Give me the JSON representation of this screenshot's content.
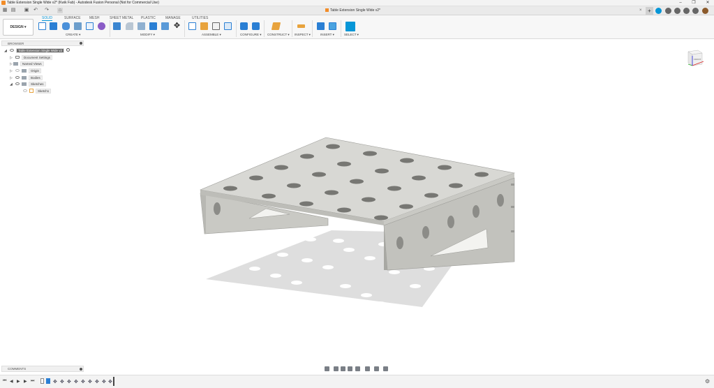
{
  "window": {
    "title": "Table Extension Single Wide v2* (Kwik Fab) - Autodesk Fusion Personal (Not for Commercial Use)",
    "minimize_label": "–",
    "maximize_label": "❐",
    "close_label": "✕"
  },
  "tabbar": {
    "document_tab": "Table Extension Single Wide v2*",
    "close_glyph": "×",
    "add_glyph": "+"
  },
  "ribbon": {
    "workspace": "DESIGN ▾",
    "tabs": [
      "SOLID",
      "SURFACE",
      "MESH",
      "SHEET METAL",
      "PLASTIC",
      "MANAGE",
      "UTILITIES"
    ],
    "active_tab": "SOLID",
    "groups": [
      "CREATE ▾",
      "MODIFY ▾",
      "ASSEMBLE ▾",
      "CONFIGURE ▾",
      "CONSTRUCT ▾",
      "INSPECT ▾",
      "INSERT ▾",
      "SELECT ▾"
    ]
  },
  "browser": {
    "header": "BROWSER",
    "root": "Table Extension Single Wide v2",
    "items": [
      "Document Settings",
      "Named Views",
      "Origin",
      "Bodies",
      "Sketches"
    ],
    "sketch": "Sketch1"
  },
  "viewcube": {
    "face_label": "FRONT"
  },
  "comments": {
    "label": "COMMENTS"
  },
  "timeline": {
    "play_controls": [
      "⏮",
      "◀",
      "▶",
      "▶",
      "⏭"
    ]
  },
  "colors": {
    "accent": "#0696d7",
    "model_fill": "#d3d3cf",
    "model_side": "#c2c2bd",
    "shadow": "#dedede"
  }
}
